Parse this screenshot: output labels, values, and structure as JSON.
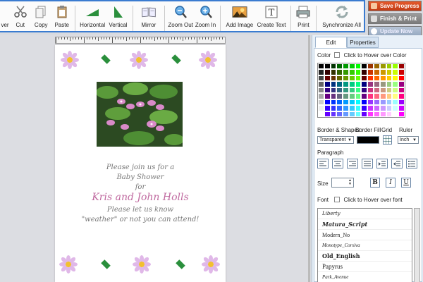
{
  "toolbar": {
    "buttons": [
      {
        "name": "cover-button",
        "label": "ver",
        "icon": "partial-icon"
      },
      {
        "name": "cut-button",
        "label": "Cut",
        "icon": "scissors-icon"
      },
      {
        "name": "copy-button",
        "label": "Copy",
        "icon": "copy-icon"
      },
      {
        "name": "paste-button",
        "label": "Paste",
        "icon": "clipboard-icon"
      },
      {
        "name": "horizontal-button",
        "label": "Horizontal",
        "icon": "horizontal-flip-icon"
      },
      {
        "name": "vertical-button",
        "label": "Vertical",
        "icon": "vertical-flip-icon"
      },
      {
        "name": "mirror-button",
        "label": "Mirror",
        "icon": "mirror-book-icon"
      },
      {
        "name": "zoom-out-button",
        "label": "Zoom Out",
        "icon": "zoom-out-icon"
      },
      {
        "name": "zoom-in-button",
        "label": "Zoom In",
        "icon": "zoom-in-icon"
      },
      {
        "name": "add-image-button",
        "label": "Add Image",
        "icon": "image-icon"
      },
      {
        "name": "create-text-button",
        "label": "Create Text",
        "icon": "text-icon"
      },
      {
        "name": "print-button",
        "label": "Print",
        "icon": "printer-icon"
      },
      {
        "name": "synchronize-all-button",
        "label": "Synchronize All",
        "icon": "sync-icon"
      }
    ]
  },
  "actions": {
    "save": "Save Progress",
    "finish": "Finish & Print",
    "update": "Update Now"
  },
  "invitation": {
    "line1": "Please join us for a",
    "line2": "Baby Shower",
    "line3": "for",
    "line4": "Kris and John Holls",
    "line5": "Please let us know",
    "line6": "\"weather\" or not you can attend!"
  },
  "panel": {
    "tabs": [
      "Edit",
      "Properties"
    ],
    "color_label": "Color",
    "color_hover": "Click to Hover over Color",
    "border_shapes_label": "Border & Shapes",
    "border_fill_label": "Border Fill",
    "grid_label": "Grid",
    "ruler_label": "Ruler",
    "border_value": "Transparent",
    "ruler_value": "Inch",
    "paragraph_label": "Paragraph",
    "size_label": "Size",
    "bold": "B",
    "italic": "I",
    "underline": "U",
    "font_label": "Font",
    "font_hover": "Click to Hover over font",
    "fonts": [
      "Liberty",
      "Matura_Script",
      "Modern_No",
      "Monotype_Corsiva",
      "Old_English",
      "Papyrus",
      "Park_Avenue"
    ]
  },
  "colors": {
    "toolbar_border": "#3a7bd0",
    "save": "#d94a1f",
    "accent_green": "#2a8f3c",
    "pink_text": "#c06aa0"
  }
}
